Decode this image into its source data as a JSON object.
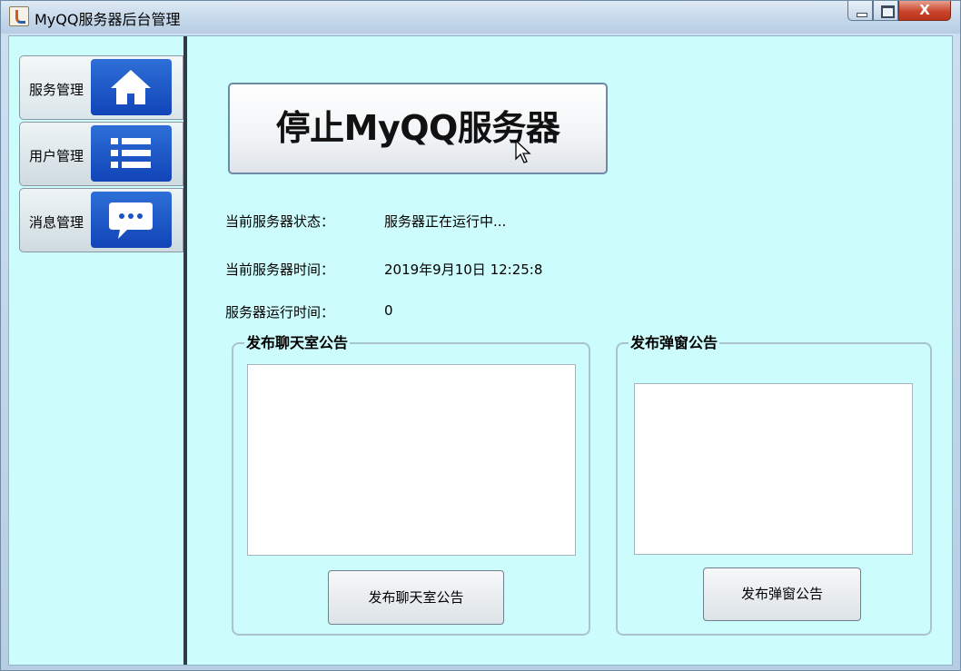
{
  "window": {
    "title": "MyQQ服务器后台管理",
    "close_glyph": "X"
  },
  "sidebar": {
    "items": [
      {
        "label": "服务管理",
        "icon": "home-icon",
        "active": true
      },
      {
        "label": "用户管理",
        "icon": "list-icon",
        "active": false
      },
      {
        "label": "消息管理",
        "icon": "chat-icon",
        "active": false
      }
    ]
  },
  "main": {
    "stop_button_label": "停止MyQQ服务器",
    "status_label": "当前服务器状态：",
    "status_value": "服务器正在运行中...",
    "time_label": "当前服务器时间：",
    "time_value": "2019年9月10日 12:25:8",
    "uptime_label": "服务器运行时间：",
    "uptime_value": "0",
    "chatroom": {
      "group_title": "发布聊天室公告",
      "text": "",
      "button_label": "发布聊天室公告"
    },
    "popup": {
      "group_title": "发布弹窗公告",
      "text": "",
      "button_label": "发布弹窗公告"
    }
  },
  "colors": {
    "client_bg": "#cdfcfc",
    "icon_blue": "#1a55c8"
  }
}
